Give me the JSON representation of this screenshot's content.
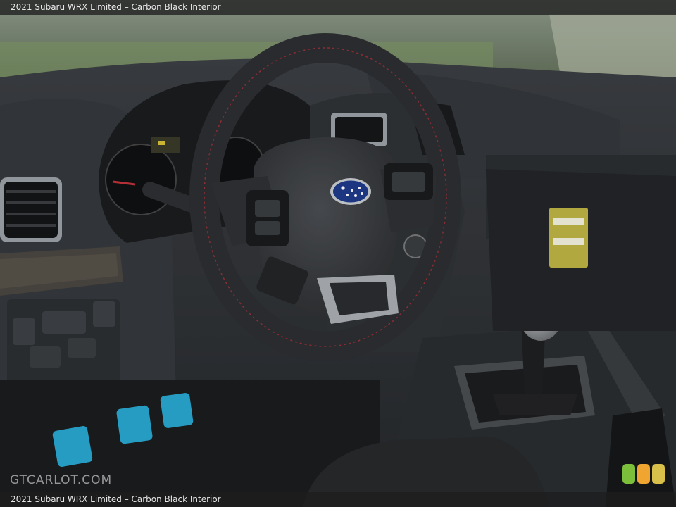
{
  "caption_top": "2021 Subaru WRX Limited – Carbon Black Interior",
  "caption_bottom": "2021 Subaru WRX Limited – Carbon Black Interior",
  "watermark": "GTCARLOT.COM",
  "badge": {
    "colors": [
      "#7bbf3a",
      "#f0a531",
      "#d8c04a"
    ]
  },
  "colors": {
    "stitching": "#c0323a",
    "pedals": "#2aa6cf",
    "subaru_badge": "#1e3a8a"
  }
}
